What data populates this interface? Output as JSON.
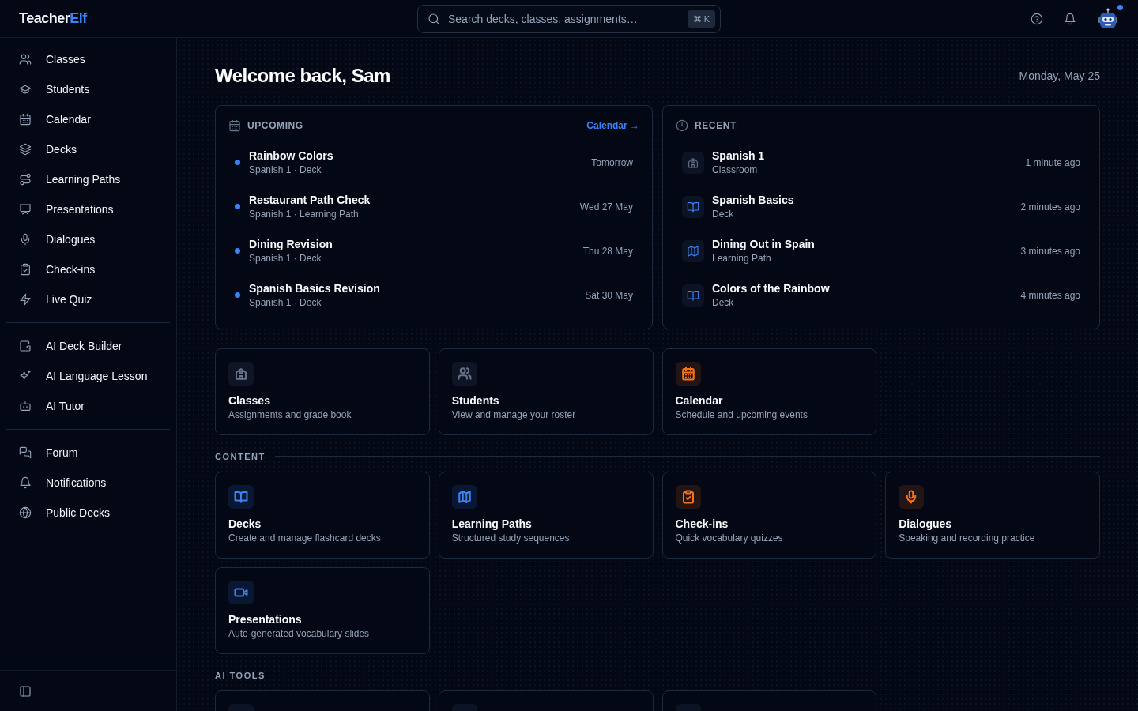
{
  "app": {
    "logo_main": "Teacher",
    "logo_accent": "Elf"
  },
  "search": {
    "placeholder": "Search decks, classes, assignments…",
    "shortcut": "⌘ K"
  },
  "avatar": {
    "badge": true
  },
  "sidebar": {
    "groups": [
      {
        "items": [
          {
            "label": "Classes",
            "selected": false
          },
          {
            "label": "Students",
            "selected": false
          },
          {
            "label": "Calendar",
            "selected": false
          },
          {
            "label": "Decks",
            "selected": false
          },
          {
            "label": "Learning Paths",
            "selected": false
          },
          {
            "label": "Presentations",
            "selected": false
          },
          {
            "label": "Dialogues",
            "selected": false
          },
          {
            "label": "Check-ins",
            "selected": false
          },
          {
            "label": "Live Quiz",
            "selected": false
          }
        ]
      },
      {
        "items": [
          {
            "label": "AI Deck Builder",
            "selected": false
          },
          {
            "label": "AI Language Lesson",
            "selected": false
          },
          {
            "label": "AI Tutor",
            "selected": false
          }
        ]
      },
      {
        "items": [
          {
            "label": "Forum",
            "selected": false
          },
          {
            "label": "Notifications",
            "selected": false
          },
          {
            "label": "Public Decks",
            "selected": false
          }
        ]
      }
    ]
  },
  "page": {
    "title": "Welcome back, Sam",
    "date": "Monday, May 25"
  },
  "upcoming": {
    "title": "UPCOMING",
    "link": "Calendar →",
    "items": [
      {
        "title": "Rainbow Colors",
        "subtitle": "Spanish 1 · Deck",
        "when": "Tomorrow"
      },
      {
        "title": "Restaurant Path Check",
        "subtitle": "Spanish 1 · Learning Path",
        "when": "Wed 27 May"
      },
      {
        "title": "Dining Revision",
        "subtitle": "Spanish 1 · Deck",
        "when": "Thu 28 May"
      },
      {
        "title": "Spanish Basics Revision",
        "subtitle": "Spanish 1 · Deck",
        "when": "Sat 30 May"
      }
    ]
  },
  "recent": {
    "title": "RECENT",
    "items": [
      {
        "title": "Spanish 1",
        "subtitle": "Classroom",
        "time": "1 minute ago",
        "kind": "classroom"
      },
      {
        "title": "Spanish Basics",
        "subtitle": "Deck",
        "time": "2 minutes ago",
        "kind": "deck"
      },
      {
        "title": "Dining Out in Spain",
        "subtitle": "Learning Path",
        "time": "3 minutes ago",
        "kind": "path"
      },
      {
        "title": "Colors of the Rainbow",
        "subtitle": "Deck",
        "time": "4 minutes ago",
        "kind": "deck"
      }
    ]
  },
  "sections": [
    {
      "cards": [
        {
          "title": "Classes",
          "description": "Assignments and grade book",
          "color": "#64748b"
        },
        {
          "title": "Students",
          "description": "View and manage your roster",
          "color": "#64748b"
        },
        {
          "title": "Calendar",
          "description": "Schedule and upcoming events",
          "color": "#f97316"
        }
      ]
    },
    {
      "title": "CONTENT",
      "cards": [
        {
          "title": "Decks",
          "description": "Create and manage flashcard decks",
          "color": "#3b82f6"
        },
        {
          "title": "Learning Paths",
          "description": "Structured study sequences",
          "color": "#3b82f6"
        },
        {
          "title": "Check-ins",
          "description": "Quick vocabulary quizzes",
          "color": "#f97316"
        },
        {
          "title": "Dialogues",
          "description": "Speaking and recording practice",
          "color": "#f97316"
        },
        {
          "title": "Presentations",
          "description": "Auto-generated vocabulary slides",
          "color": "#3b82f6"
        }
      ]
    },
    {
      "title": "AI TOOLS",
      "cards": [
        {
          "kind": "card"
        },
        {
          "kind": "card"
        },
        {
          "kind": "card"
        }
      ]
    }
  ]
}
